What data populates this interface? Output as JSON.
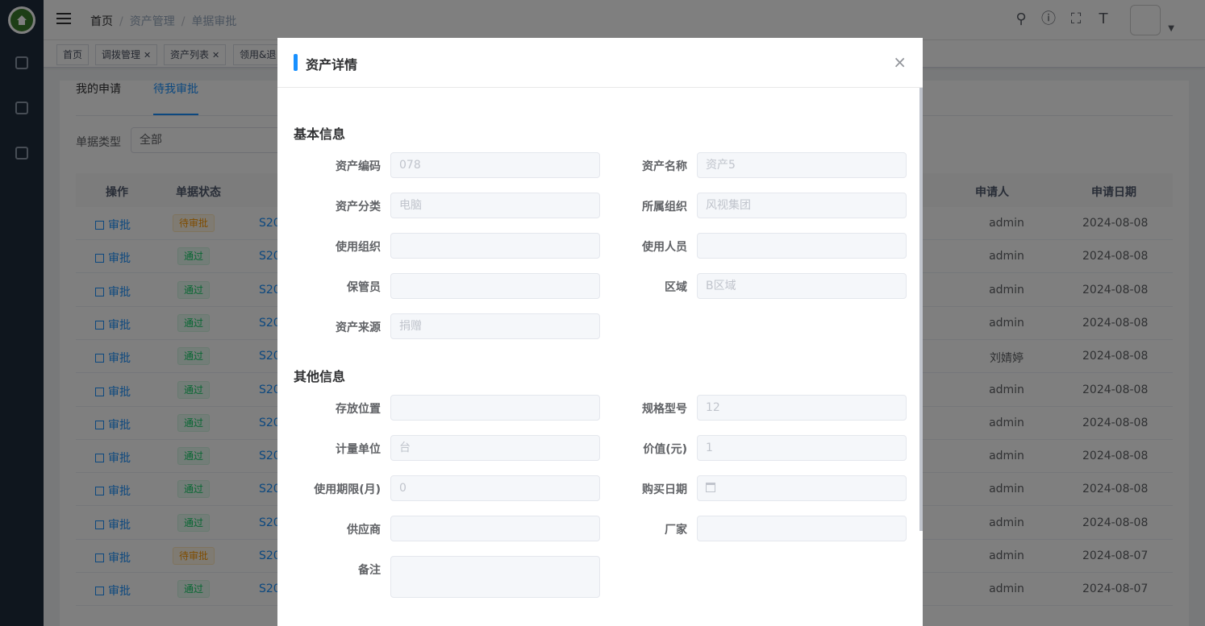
{
  "header": {
    "breadcrumb": [
      "首页",
      "资产管理",
      "单据审批"
    ]
  },
  "tags": [
    {
      "label": "首页",
      "closable": false
    },
    {
      "label": "调拨管理",
      "closable": true
    },
    {
      "label": "资产列表",
      "closable": true
    },
    {
      "label": "领用&退",
      "closable": false
    }
  ],
  "tabs": [
    "我的申请",
    "待我审批"
  ],
  "filter": {
    "label": "单据类型",
    "value": "全部"
  },
  "table": {
    "headers": {
      "op": "操作",
      "status": "单据状态",
      "applicant": "申请人",
      "date": "申请日期"
    },
    "rows": [
      {
        "op": "审批",
        "status": "待审批",
        "docno": "S20",
        "applicant": "admin",
        "date": "2024-08-08"
      },
      {
        "op": "审批",
        "status": "通过",
        "docno": "S20",
        "applicant": "admin",
        "date": "2024-08-08"
      },
      {
        "op": "审批",
        "status": "通过",
        "docno": "S20",
        "applicant": "admin",
        "date": "2024-08-08"
      },
      {
        "op": "审批",
        "status": "通过",
        "docno": "S20",
        "applicant": "admin",
        "date": "2024-08-08"
      },
      {
        "op": "审批",
        "status": "通过",
        "docno": "S20",
        "applicant": "刘婧婷",
        "date": "2024-08-08"
      },
      {
        "op": "审批",
        "status": "通过",
        "docno": "S20",
        "applicant": "admin",
        "date": "2024-08-08"
      },
      {
        "op": "审批",
        "status": "通过",
        "docno": "S20",
        "applicant": "admin",
        "date": "2024-08-08"
      },
      {
        "op": "审批",
        "status": "通过",
        "docno": "S20",
        "applicant": "admin",
        "date": "2024-08-08"
      },
      {
        "op": "审批",
        "status": "通过",
        "docno": "S20",
        "applicant": "admin",
        "date": "2024-08-08"
      },
      {
        "op": "审批",
        "status": "通过",
        "docno": "S20",
        "applicant": "admin",
        "date": "2024-08-08"
      },
      {
        "op": "审批",
        "status": "待审批",
        "docno": "S20",
        "applicant": "admin",
        "date": "2024-08-07"
      },
      {
        "op": "审批",
        "status": "通过",
        "docno": "S20",
        "applicant": "admin",
        "date": "2024-08-07"
      }
    ]
  },
  "dialog": {
    "title": "资产详情",
    "close": "×",
    "basic_section": "基本信息",
    "other_section": "其他信息",
    "fields": {
      "asset_code": {
        "label": "资产编码",
        "value": "078"
      },
      "asset_name": {
        "label": "资产名称",
        "value": "资产5"
      },
      "asset_category": {
        "label": "资产分类",
        "value": "电脑"
      },
      "owner_org": {
        "label": "所属组织",
        "value": "风视集团"
      },
      "use_org": {
        "label": "使用组织",
        "value": ""
      },
      "user": {
        "label": "使用人员",
        "value": ""
      },
      "custodian": {
        "label": "保管员",
        "value": ""
      },
      "region": {
        "label": "区域",
        "value": "B区域"
      },
      "source": {
        "label": "资产来源",
        "value": "捐赠"
      },
      "location": {
        "label": "存放位置",
        "value": ""
      },
      "spec": {
        "label": "规格型号",
        "value": "12"
      },
      "unit": {
        "label": "计量单位",
        "value": "台"
      },
      "value": {
        "label": "价值(元)",
        "value": "1"
      },
      "period": {
        "label": "使用期限(月)",
        "value": "0"
      },
      "purchase_date": {
        "label": "购买日期",
        "value": ""
      },
      "supplier": {
        "label": "供应商",
        "value": ""
      },
      "manufacturer": {
        "label": "厂家",
        "value": ""
      },
      "remark": {
        "label": "备注",
        "value": ""
      }
    }
  },
  "colors": {
    "primary": "#1890ff",
    "sidebar": "#1f2d3d",
    "pending": "#ff9900",
    "passed": "#13ce66"
  }
}
